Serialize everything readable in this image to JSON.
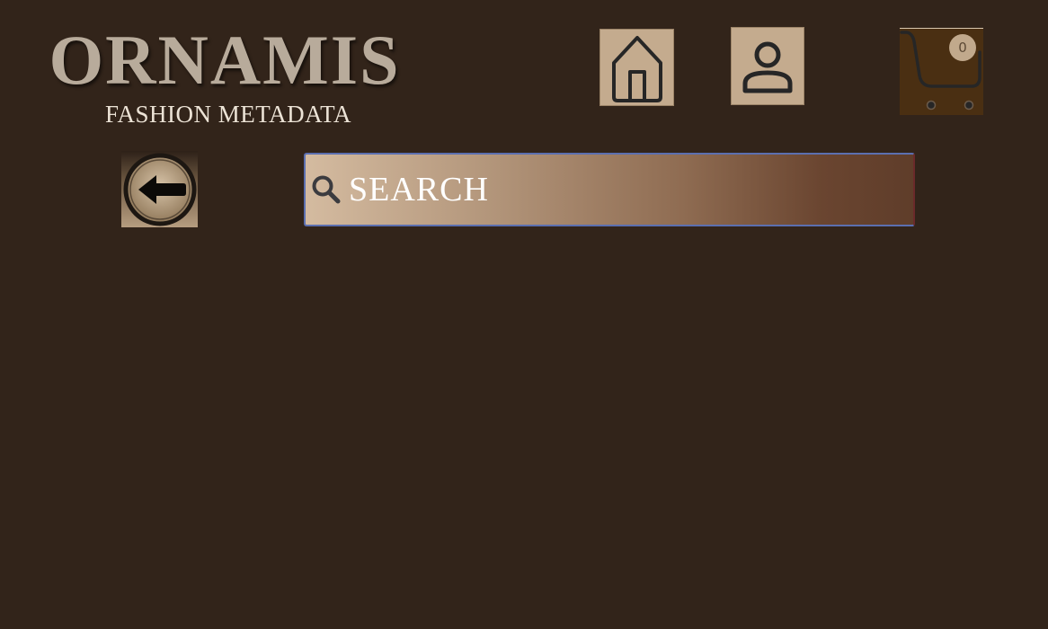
{
  "brand": {
    "name": "ORNAMIS",
    "tagline": "FASHION METADATA"
  },
  "nav": {
    "home_icon": "home-icon",
    "account_icon": "user-icon",
    "cart_icon": "cart-icon",
    "cart_count": "0"
  },
  "back": {
    "icon": "arrow-left-icon"
  },
  "search": {
    "placeholder": "SEARCH",
    "value": "",
    "icon": "search-icon"
  },
  "colors": {
    "background": "#32241a",
    "logo": "#b8ab9b",
    "tagline": "#ece3d6",
    "icon_tile": "#c4ab8e",
    "cart_tile": "#4a2f12",
    "search_start": "#d4bba0",
    "search_end": "#5f3d2a"
  }
}
